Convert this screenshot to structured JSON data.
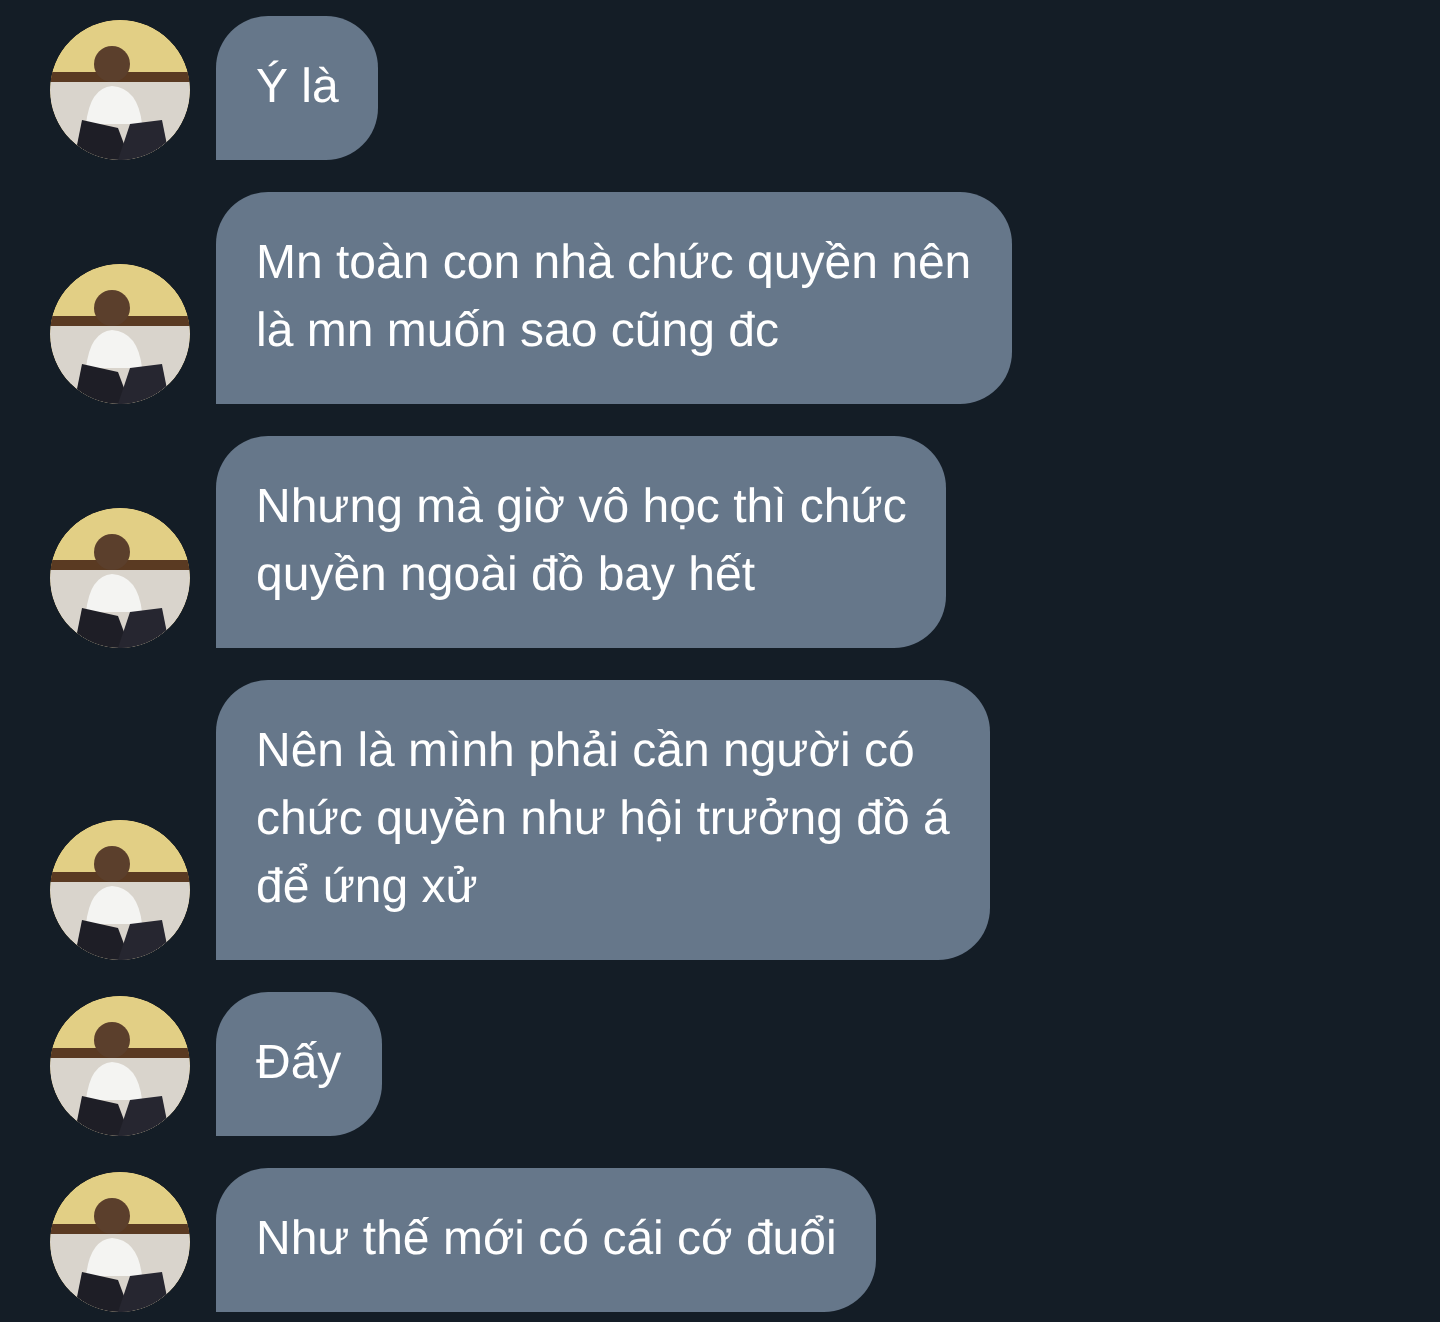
{
  "messages": [
    {
      "lines": [
        "Ý là"
      ]
    },
    {
      "lines": [
        "Mn toàn con nhà chức quyền nên",
        "là mn muốn sao cũng đc"
      ]
    },
    {
      "lines": [
        "Nhưng mà giờ vô học thì chức",
        "quyền ngoài đồ bay hết"
      ]
    },
    {
      "lines": [
        "Nên là mình phải cần người có",
        "chức quyền như hội trưởng đồ á",
        "để ứng xử"
      ]
    },
    {
      "lines": [
        "Đấy"
      ]
    },
    {
      "lines": [
        "Như thế mới có cái cớ đuổi"
      ]
    }
  ]
}
